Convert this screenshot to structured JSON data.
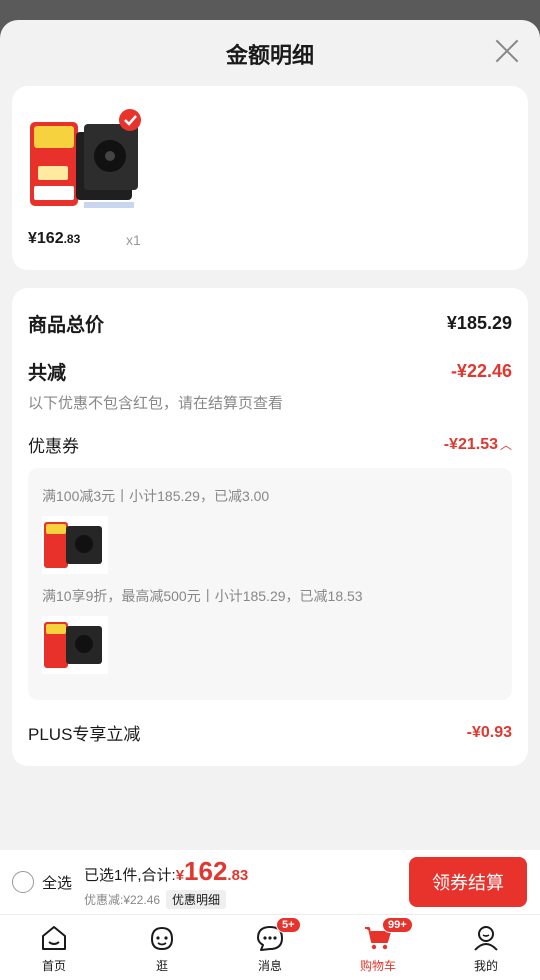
{
  "sheet": {
    "title": "金额明细"
  },
  "product": {
    "price_main": "¥162",
    "price_decimal": ".83",
    "qty": "x1"
  },
  "summary": {
    "total_label": "商品总价",
    "total_value": "¥185.29",
    "reduce_label": "共减",
    "reduce_value": "-¥22.46",
    "reduce_note": "以下优惠不包含红包，请在结算页查看",
    "coupon_label": "优惠券",
    "coupon_value": "-¥21.53",
    "coupons": [
      {
        "text": "满100减3元丨小计185.29，已减3.00"
      },
      {
        "text": "满10享9折，最高减500元丨小计185.29，已减18.53"
      }
    ],
    "plus_label": "PLUS专享立减",
    "plus_value": "-¥0.93"
  },
  "bottom": {
    "select_all": "全选",
    "selected_text": "已选1件,合计:",
    "currency": "¥",
    "amount_int": "162",
    "amount_dec": ".83",
    "discount_text": "优惠减:¥22.46",
    "detail_chip": "优惠明细",
    "checkout": "领券结算"
  },
  "tabs": [
    {
      "label": "首页",
      "icon": "home-icon"
    },
    {
      "label": "逛",
      "icon": "smiley-icon"
    },
    {
      "label": "消息",
      "icon": "message-icon",
      "badge": "5+"
    },
    {
      "label": "购物车",
      "icon": "cart-icon",
      "badge": "99+",
      "active": true
    },
    {
      "label": "我的",
      "icon": "profile-icon"
    }
  ],
  "colors": {
    "accent": "#e0382f",
    "button": "#e8322c"
  }
}
